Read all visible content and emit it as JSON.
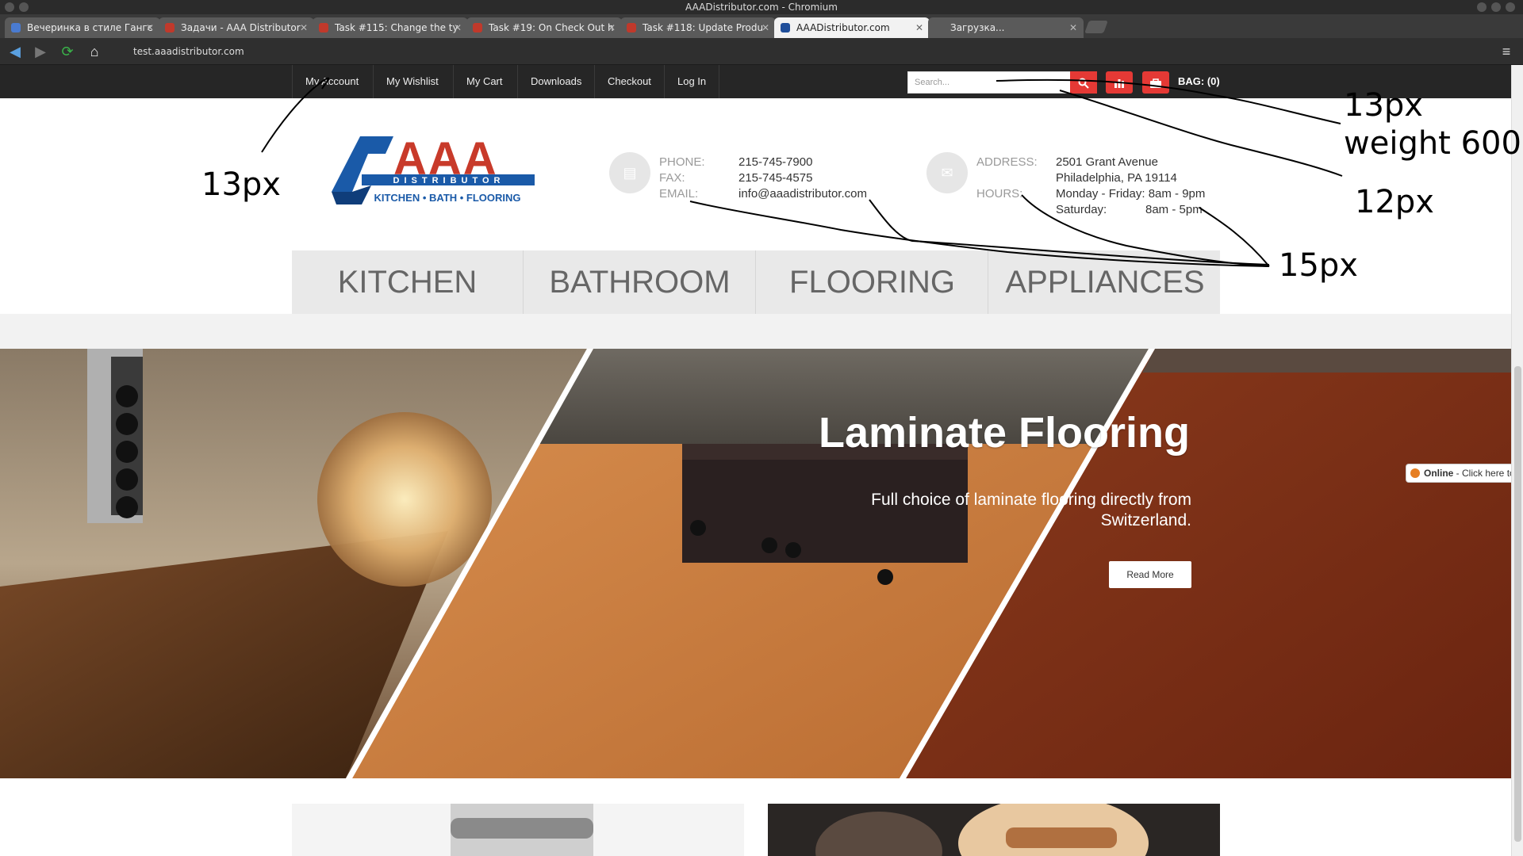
{
  "window": {
    "title": "AAADistributor.com - Chromium"
  },
  "tabs": [
    {
      "label": "Вечеринка в стиле Гангс"
    },
    {
      "label": "Задачи - AAA Distributor"
    },
    {
      "label": "Task #115: Change the ty"
    },
    {
      "label": "Task #19: On Check Out h"
    },
    {
      "label": "Task #118: Update Produ"
    },
    {
      "label": "AAADistributor.com"
    },
    {
      "label": "Загрузка..."
    }
  ],
  "address_bar": {
    "url": "test.aaadistributor.com"
  },
  "top_nav": {
    "links": [
      "My Account",
      "My Wishlist",
      "My Cart",
      "Downloads",
      "Checkout",
      "Log In"
    ],
    "search_placeholder": "Search...",
    "bag_label": "BAG: (0)"
  },
  "logo": {
    "letters": "AAA",
    "distributor": "DISTRIBUTOR",
    "tagline": "KITCHEN • BATH • FLOORING"
  },
  "contact": {
    "phone_label": "PHONE:",
    "phone": "215-745-7900",
    "fax_label": "FAX:",
    "fax": "215-745-4575",
    "email_label": "EMAIL:",
    "email": "info@aaadistributor.com"
  },
  "location": {
    "address_label": "ADDRESS:",
    "address_line1": "2501 Grant Avenue",
    "address_line2": "Philadelphia, PA 19114",
    "hours_label": "HOURS:",
    "hours_weekday": "Monday - Friday: 8am - 9pm",
    "hours_sat_label": "Saturday:",
    "hours_sat": "8am - 5pm"
  },
  "categories": [
    "KITCHEN",
    "BATHROOM",
    "FLOORING",
    "APPLIANCES"
  ],
  "hero": {
    "title": "Laminate Flooring",
    "subtitle": "Full choice of laminate flooring directly from Switzerland.",
    "button": "Read More"
  },
  "chat": {
    "status": "Online",
    "text": " - Click here to"
  },
  "annotations": [
    "13px",
    "13px",
    "weight 600",
    "12px",
    "15px"
  ],
  "colors": {
    "accent_red": "#e53935",
    "topbar": "#262626",
    "nav_bg": "#e9e9e9"
  }
}
